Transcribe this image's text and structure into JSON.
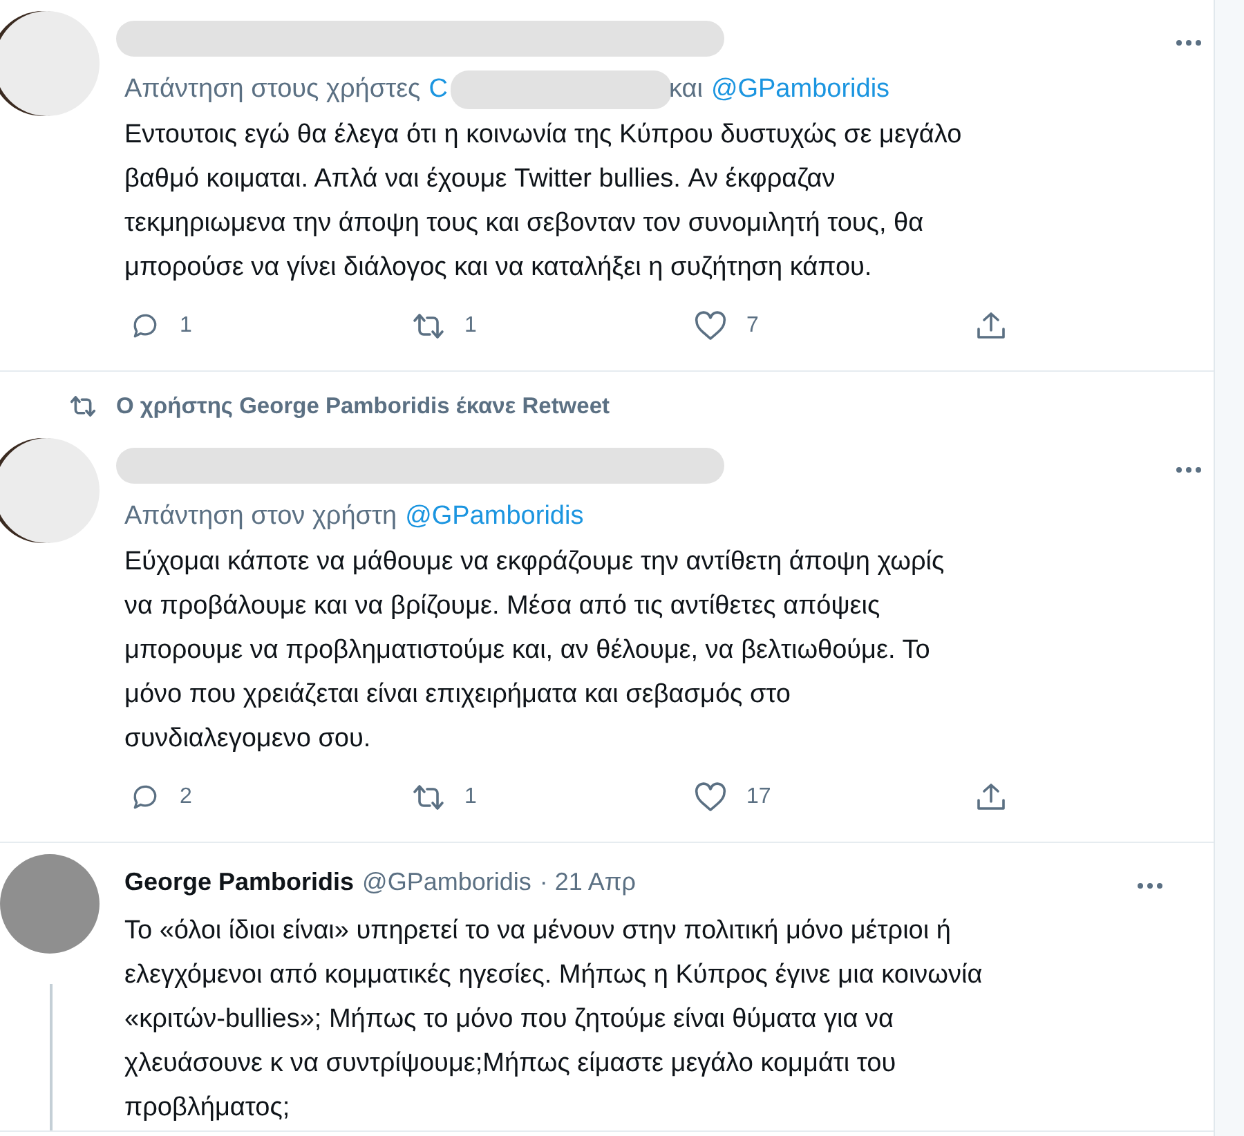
{
  "tweets": [
    {
      "author_redacted": true,
      "reply_to": [
        {
          "kind": "text",
          "text": "Απάντηση στους χρήστες"
        },
        {
          "kind": "link",
          "text": "C"
        },
        {
          "kind": "redacted"
        },
        {
          "kind": "text",
          "text": "και"
        },
        {
          "kind": "link",
          "text": "@GPamboridis"
        }
      ],
      "text": "Εντουτοις εγώ θα έλεγα ότι η κοινωνία της Κύπρου δυστυχώς σε μεγάλο\nβαθμό κοιμαται. Απλά ναι έχουμε Twitter bullies. Αν έκφραζαν\nτεκμηριωμενα την άποψη τους και σεβονταν τον συνομιλητή τους, θα\nμπορούσε να γίνει διάλογος και να καταλήξει η συζήτηση κάπου.",
      "stats": {
        "replies": "1",
        "retweets": "1",
        "likes": "7"
      },
      "thread_line": false,
      "photo_avatar": false
    },
    {
      "author_redacted": true,
      "retweeted_by": "Ο χρήστης George Pamboridis έκανε Retweet",
      "reply_to": [
        {
          "kind": "text",
          "text": "Απάντηση στον χρήστη"
        },
        {
          "kind": "link",
          "text": "@GPamboridis"
        }
      ],
      "text": "Εύχομαι κάποτε να μάθουμε να εκφράζουμε την αντίθετη άποψη χωρίς\nνα προβάλουμε και να βρίζουμε. Μέσα από τις αντίθετες απόψεις\nμπορουμε να προβληματιστούμε και, αν θέλουμε, να βελτιωθούμε. Το\nμόνο που χρειάζεται είναι επιχειρήματα και σεβασμός στο\nσυνδιαλεγομενο σου.",
      "stats": {
        "replies": "2",
        "retweets": "1",
        "likes": "17"
      },
      "thread_line": false,
      "photo_avatar": false
    },
    {
      "author_redacted": false,
      "author": {
        "name": "George Pamboridis",
        "handle": "@GPamboridis",
        "date": "· 21 Απρ"
      },
      "text": "Το «όλοι ίδιοι είναι» υπηρετεί το να μένουν στην πολιτική μόνο μέτριοι ή\nελεγχόμενοι από κομματικές ηγεσίες. Μήπως η Κύπρος έγινε μια κοινωνία\n«κριτών-bullies»; Μήπως το μόνο που ζητούμε είναι θύματα για να\nχλευάσουνε κ να συντρίψουμε;Μήπως είμαστε μεγάλο κομμάτι του\nπροβλήματος;",
      "thread_line": true,
      "photo_avatar": true
    }
  ]
}
